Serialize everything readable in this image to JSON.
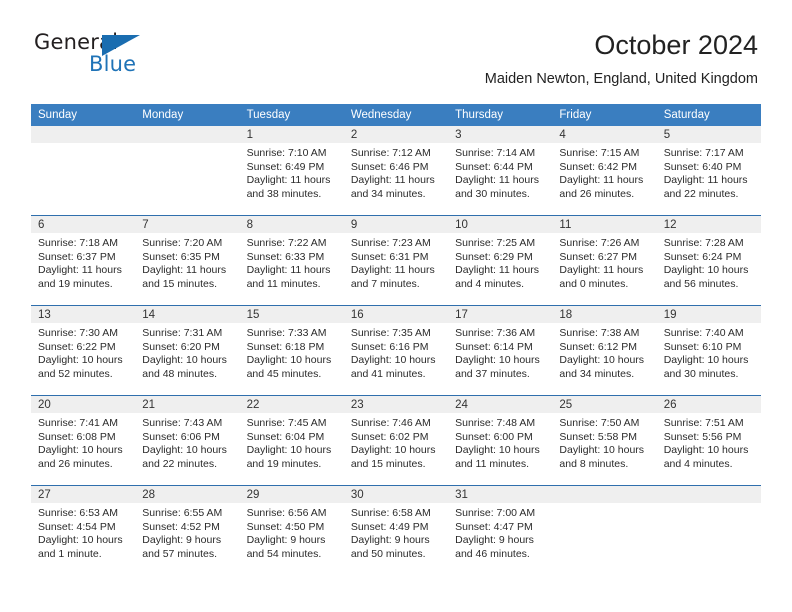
{
  "brand": {
    "name_part1": "General",
    "name_part2": "Blue",
    "logo_icon": "blue-triangle-logo"
  },
  "header": {
    "title": "October 2024",
    "location": "Maiden Newton, England, United Kingdom"
  },
  "colors": {
    "header_blue": "#3a7ec0",
    "row_divider_blue": "#2f6fad",
    "daynum_band": "#efefef",
    "brand_blue": "#1f73b7",
    "text": "#222222"
  },
  "weekday_headers": [
    "Sunday",
    "Monday",
    "Tuesday",
    "Wednesday",
    "Thursday",
    "Friday",
    "Saturday"
  ],
  "weeks": [
    [
      {
        "day": "",
        "sunrise": "",
        "sunset": "",
        "daylight": "",
        "empty": true
      },
      {
        "day": "",
        "sunrise": "",
        "sunset": "",
        "daylight": "",
        "empty": true
      },
      {
        "day": "1",
        "sunrise": "Sunrise: 7:10 AM",
        "sunset": "Sunset: 6:49 PM",
        "daylight": "Daylight: 11 hours and 38 minutes.",
        "empty": false
      },
      {
        "day": "2",
        "sunrise": "Sunrise: 7:12 AM",
        "sunset": "Sunset: 6:46 PM",
        "daylight": "Daylight: 11 hours and 34 minutes.",
        "empty": false
      },
      {
        "day": "3",
        "sunrise": "Sunrise: 7:14 AM",
        "sunset": "Sunset: 6:44 PM",
        "daylight": "Daylight: 11 hours and 30 minutes.",
        "empty": false
      },
      {
        "day": "4",
        "sunrise": "Sunrise: 7:15 AM",
        "sunset": "Sunset: 6:42 PM",
        "daylight": "Daylight: 11 hours and 26 minutes.",
        "empty": false
      },
      {
        "day": "5",
        "sunrise": "Sunrise: 7:17 AM",
        "sunset": "Sunset: 6:40 PM",
        "daylight": "Daylight: 11 hours and 22 minutes.",
        "empty": false
      }
    ],
    [
      {
        "day": "6",
        "sunrise": "Sunrise: 7:18 AM",
        "sunset": "Sunset: 6:37 PM",
        "daylight": "Daylight: 11 hours and 19 minutes.",
        "empty": false
      },
      {
        "day": "7",
        "sunrise": "Sunrise: 7:20 AM",
        "sunset": "Sunset: 6:35 PM",
        "daylight": "Daylight: 11 hours and 15 minutes.",
        "empty": false
      },
      {
        "day": "8",
        "sunrise": "Sunrise: 7:22 AM",
        "sunset": "Sunset: 6:33 PM",
        "daylight": "Daylight: 11 hours and 11 minutes.",
        "empty": false
      },
      {
        "day": "9",
        "sunrise": "Sunrise: 7:23 AM",
        "sunset": "Sunset: 6:31 PM",
        "daylight": "Daylight: 11 hours and 7 minutes.",
        "empty": false
      },
      {
        "day": "10",
        "sunrise": "Sunrise: 7:25 AM",
        "sunset": "Sunset: 6:29 PM",
        "daylight": "Daylight: 11 hours and 4 minutes.",
        "empty": false
      },
      {
        "day": "11",
        "sunrise": "Sunrise: 7:26 AM",
        "sunset": "Sunset: 6:27 PM",
        "daylight": "Daylight: 11 hours and 0 minutes.",
        "empty": false
      },
      {
        "day": "12",
        "sunrise": "Sunrise: 7:28 AM",
        "sunset": "Sunset: 6:24 PM",
        "daylight": "Daylight: 10 hours and 56 minutes.",
        "empty": false
      }
    ],
    [
      {
        "day": "13",
        "sunrise": "Sunrise: 7:30 AM",
        "sunset": "Sunset: 6:22 PM",
        "daylight": "Daylight: 10 hours and 52 minutes.",
        "empty": false
      },
      {
        "day": "14",
        "sunrise": "Sunrise: 7:31 AM",
        "sunset": "Sunset: 6:20 PM",
        "daylight": "Daylight: 10 hours and 48 minutes.",
        "empty": false
      },
      {
        "day": "15",
        "sunrise": "Sunrise: 7:33 AM",
        "sunset": "Sunset: 6:18 PM",
        "daylight": "Daylight: 10 hours and 45 minutes.",
        "empty": false
      },
      {
        "day": "16",
        "sunrise": "Sunrise: 7:35 AM",
        "sunset": "Sunset: 6:16 PM",
        "daylight": "Daylight: 10 hours and 41 minutes.",
        "empty": false
      },
      {
        "day": "17",
        "sunrise": "Sunrise: 7:36 AM",
        "sunset": "Sunset: 6:14 PM",
        "daylight": "Daylight: 10 hours and 37 minutes.",
        "empty": false
      },
      {
        "day": "18",
        "sunrise": "Sunrise: 7:38 AM",
        "sunset": "Sunset: 6:12 PM",
        "daylight": "Daylight: 10 hours and 34 minutes.",
        "empty": false
      },
      {
        "day": "19",
        "sunrise": "Sunrise: 7:40 AM",
        "sunset": "Sunset: 6:10 PM",
        "daylight": "Daylight: 10 hours and 30 minutes.",
        "empty": false
      }
    ],
    [
      {
        "day": "20",
        "sunrise": "Sunrise: 7:41 AM",
        "sunset": "Sunset: 6:08 PM",
        "daylight": "Daylight: 10 hours and 26 minutes.",
        "empty": false
      },
      {
        "day": "21",
        "sunrise": "Sunrise: 7:43 AM",
        "sunset": "Sunset: 6:06 PM",
        "daylight": "Daylight: 10 hours and 22 minutes.",
        "empty": false
      },
      {
        "day": "22",
        "sunrise": "Sunrise: 7:45 AM",
        "sunset": "Sunset: 6:04 PM",
        "daylight": "Daylight: 10 hours and 19 minutes.",
        "empty": false
      },
      {
        "day": "23",
        "sunrise": "Sunrise: 7:46 AM",
        "sunset": "Sunset: 6:02 PM",
        "daylight": "Daylight: 10 hours and 15 minutes.",
        "empty": false
      },
      {
        "day": "24",
        "sunrise": "Sunrise: 7:48 AM",
        "sunset": "Sunset: 6:00 PM",
        "daylight": "Daylight: 10 hours and 11 minutes.",
        "empty": false
      },
      {
        "day": "25",
        "sunrise": "Sunrise: 7:50 AM",
        "sunset": "Sunset: 5:58 PM",
        "daylight": "Daylight: 10 hours and 8 minutes.",
        "empty": false
      },
      {
        "day": "26",
        "sunrise": "Sunrise: 7:51 AM",
        "sunset": "Sunset: 5:56 PM",
        "daylight": "Daylight: 10 hours and 4 minutes.",
        "empty": false
      }
    ],
    [
      {
        "day": "27",
        "sunrise": "Sunrise: 6:53 AM",
        "sunset": "Sunset: 4:54 PM",
        "daylight": "Daylight: 10 hours and 1 minute.",
        "empty": false
      },
      {
        "day": "28",
        "sunrise": "Sunrise: 6:55 AM",
        "sunset": "Sunset: 4:52 PM",
        "daylight": "Daylight: 9 hours and 57 minutes.",
        "empty": false
      },
      {
        "day": "29",
        "sunrise": "Sunrise: 6:56 AM",
        "sunset": "Sunset: 4:50 PM",
        "daylight": "Daylight: 9 hours and 54 minutes.",
        "empty": false
      },
      {
        "day": "30",
        "sunrise": "Sunrise: 6:58 AM",
        "sunset": "Sunset: 4:49 PM",
        "daylight": "Daylight: 9 hours and 50 minutes.",
        "empty": false
      },
      {
        "day": "31",
        "sunrise": "Sunrise: 7:00 AM",
        "sunset": "Sunset: 4:47 PM",
        "daylight": "Daylight: 9 hours and 46 minutes.",
        "empty": false
      },
      {
        "day": "",
        "sunrise": "",
        "sunset": "",
        "daylight": "",
        "empty": true
      },
      {
        "day": "",
        "sunrise": "",
        "sunset": "",
        "daylight": "",
        "empty": true
      }
    ]
  ]
}
